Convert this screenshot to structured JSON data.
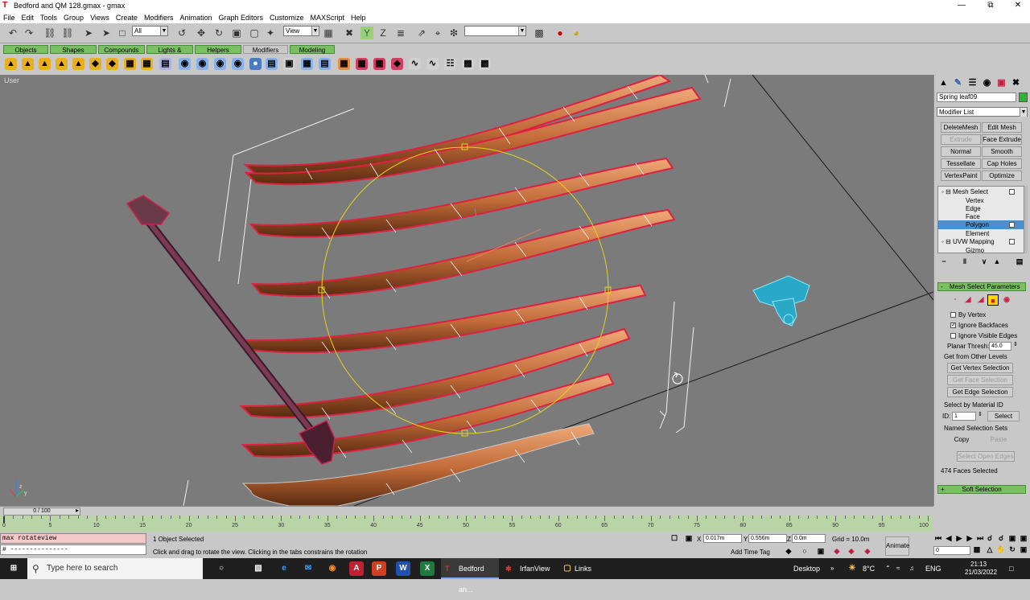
{
  "window": {
    "title": "Bedford and QM 128.gmax - gmax"
  },
  "menu": [
    "File",
    "Edit",
    "Tools",
    "Group",
    "Views",
    "Create",
    "Modifiers",
    "Animation",
    "Graph Editors",
    "Customize",
    "MAXScript",
    "Help"
  ],
  "toolbar": {
    "selection_filter": "All",
    "ref_coord": "View",
    "named_sel": ""
  },
  "tabs": [
    "Objects",
    "Shapes",
    "Compounds",
    "Lights & Cameras",
    "Helpers",
    "Modifiers",
    "Modeling"
  ],
  "active_tab": "Modifiers",
  "viewport": {
    "label": "User"
  },
  "command_panel": {
    "object_name": "Spring leaf09",
    "object_color": "#2fb52f",
    "modifier_list": "Modifier List",
    "buttons": [
      "DeleteMesh",
      "Edit Mesh",
      "Extrude",
      "Face Extrude",
      "Normal",
      "Smooth",
      "Tessellate",
      "Cap Holes",
      "VertexPaint",
      "Optimize"
    ],
    "disabled_buttons": [
      "Extrude"
    ],
    "stack": [
      {
        "label": "Mesh Select",
        "level": 0
      },
      {
        "label": "Vertex",
        "level": 1
      },
      {
        "label": "Edge",
        "level": 1
      },
      {
        "label": "Face",
        "level": 1
      },
      {
        "label": "Polygon",
        "level": 1,
        "selected": true
      },
      {
        "label": "Element",
        "level": 1
      },
      {
        "label": "UVW Mapping",
        "level": 0
      },
      {
        "label": "Gizmo",
        "level": 1
      }
    ],
    "rollout_params": "Mesh Select Parameters",
    "by_vertex": "By Vertex",
    "ignore_backfaces": "Ignore Backfaces",
    "ignore_visible_edges": "Ignore Visible Edges",
    "planar_thresh_label": "Planar Thresh:",
    "planar_thresh_value": "45.0",
    "get_from_other": "Get from Other Levels",
    "get_vertex": "Get Vertex Selection",
    "get_face": "Get Face Selection",
    "get_edge": "Get Edge Selection",
    "select_by_material": "Select by Material ID",
    "id_label": "ID:",
    "id_value": "1",
    "select_btn": "Select",
    "named_sets": "Named Selection Sets",
    "copy": "Copy",
    "paste": "Paste",
    "select_open_edges": "Select Open Edges",
    "faces_selected": "474 Faces Selected",
    "soft_selection": "Soft Selection"
  },
  "timeline": {
    "frame_display": "0 / 100",
    "ticks": [
      0,
      5,
      10,
      15,
      20,
      25,
      30,
      35,
      40,
      45,
      50,
      55,
      60,
      65,
      70,
      75,
      80,
      85,
      90,
      95,
      100
    ]
  },
  "status": {
    "maxscript_1": "max rotateview",
    "maxscript_2": "# ---------------",
    "selected": "1 Object Selected",
    "prompt": "Click and drag to rotate the view.  Clicking in the tabs constrains the rotation",
    "x": "0.017m",
    "y": "0.556m",
    "z": "0.0m",
    "grid": "Grid = 10.0m",
    "add_time_tag": "Add Time Tag",
    "animate": "Animate",
    "frame": "0"
  },
  "taskbar": {
    "search": "Type here to search",
    "apps": [
      "Bedford an...",
      "IrfanView",
      "Links"
    ],
    "desktop": "Desktop",
    "temp": "8°C",
    "lang": "ENG",
    "time": "21:13",
    "date": "21/03/2022"
  }
}
